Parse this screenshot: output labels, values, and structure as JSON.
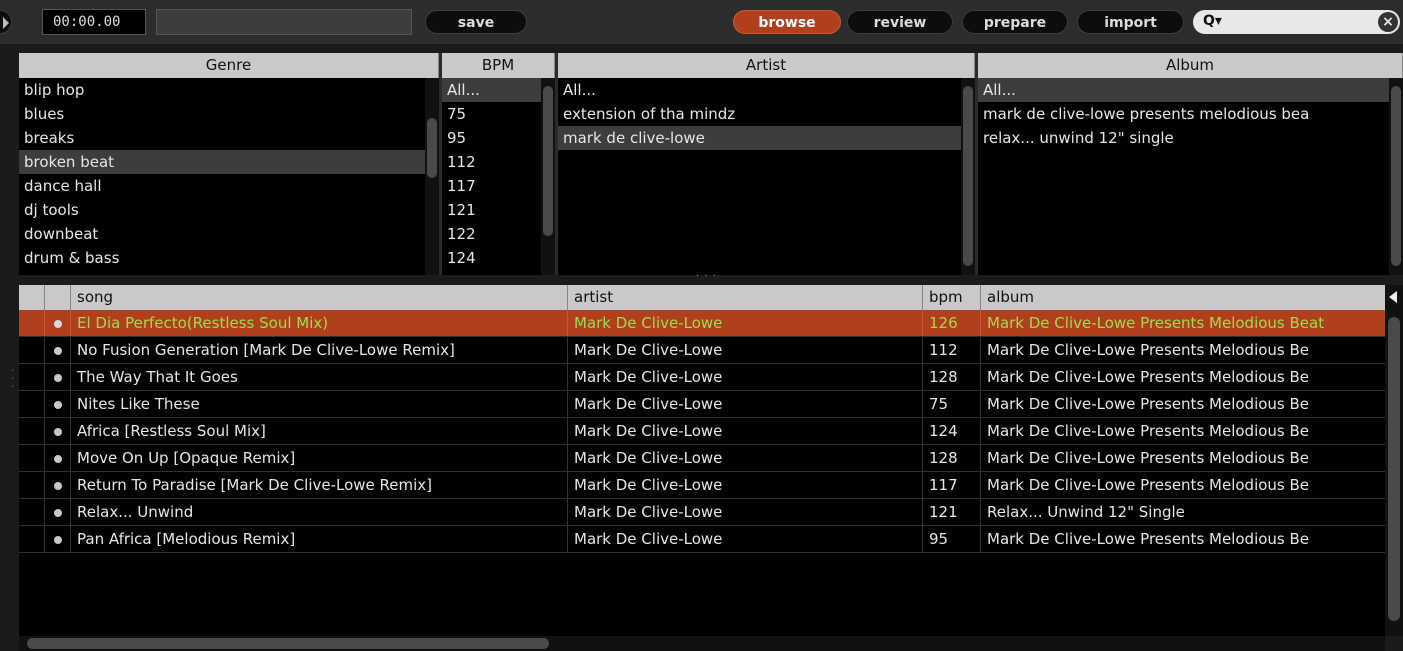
{
  "toolbar": {
    "time": "00:00.00",
    "save_label": "save",
    "modes": [
      {
        "label": "browse",
        "active": true
      },
      {
        "label": "review",
        "active": false
      },
      {
        "label": "prepare",
        "active": false
      },
      {
        "label": "import",
        "active": false
      }
    ],
    "search_icon": "search-dropdown-icon",
    "clear_icon": "close-icon"
  },
  "browser": {
    "genre": {
      "header": "Genre",
      "items": [
        "blip hop",
        "blues",
        "breaks",
        "broken beat",
        "dance hall",
        "dj tools",
        "downbeat",
        "drum & bass"
      ],
      "selected": 3
    },
    "bpm": {
      "header": "BPM",
      "items": [
        "All...",
        "75",
        "95",
        "112",
        "117",
        "121",
        "122",
        "124"
      ],
      "selected": 0
    },
    "artist": {
      "header": "Artist",
      "items": [
        "All...",
        "extension of tha mindz",
        "mark de clive-lowe"
      ],
      "selected": 2
    },
    "album": {
      "header": "Album",
      "items": [
        "All...",
        "mark de clive-lowe presents melodious bea",
        "relax... unwind 12\" single"
      ],
      "selected": 0
    }
  },
  "tracks": {
    "columns": {
      "song": "song",
      "artist": "artist",
      "bpm": "bpm",
      "album": "album"
    },
    "rows": [
      {
        "song": "El Dia Perfecto(Restless Soul Mix)",
        "artist": "Mark De Clive-Lowe",
        "bpm": "126",
        "album": "Mark De Clive-Lowe Presents Melodious Beat",
        "playing": true
      },
      {
        "song": "No Fusion Generation [Mark De Clive-Lowe Remix]",
        "artist": "Mark De Clive-Lowe",
        "bpm": "112",
        "album": "Mark De Clive-Lowe Presents Melodious Be"
      },
      {
        "song": "The Way That It Goes",
        "artist": "Mark De Clive-Lowe",
        "bpm": "128",
        "album": "Mark De Clive-Lowe Presents Melodious Be"
      },
      {
        "song": "Nites Like These",
        "artist": "Mark De Clive-Lowe",
        "bpm": "75",
        "album": "Mark De Clive-Lowe Presents Melodious Be"
      },
      {
        "song": "Africa [Restless Soul Mix]",
        "artist": "Mark De Clive-Lowe",
        "bpm": "124",
        "album": "Mark De Clive-Lowe Presents Melodious Be"
      },
      {
        "song": "Move On Up [Opaque Remix]",
        "artist": "Mark De Clive-Lowe",
        "bpm": "128",
        "album": "Mark De Clive-Lowe Presents Melodious Be"
      },
      {
        "song": "Return To Paradise [Mark De Clive-Lowe Remix]",
        "artist": "Mark De Clive-Lowe",
        "bpm": "117",
        "album": "Mark De Clive-Lowe Presents Melodious Be"
      },
      {
        "song": "Relax... Unwind",
        "artist": "Mark De Clive-Lowe",
        "bpm": "121",
        "album": "Relax... Unwind 12\" Single"
      },
      {
        "song": "Pan Africa [Melodious Remix]",
        "artist": "Mark De Clive-Lowe",
        "bpm": "95",
        "album": "Mark De Clive-Lowe Presents Melodious Be"
      }
    ]
  },
  "colors": {
    "accent": "#b0401d",
    "playing_text": "#9fdc4c",
    "background": "#000000",
    "header": "#c9c9c9"
  }
}
